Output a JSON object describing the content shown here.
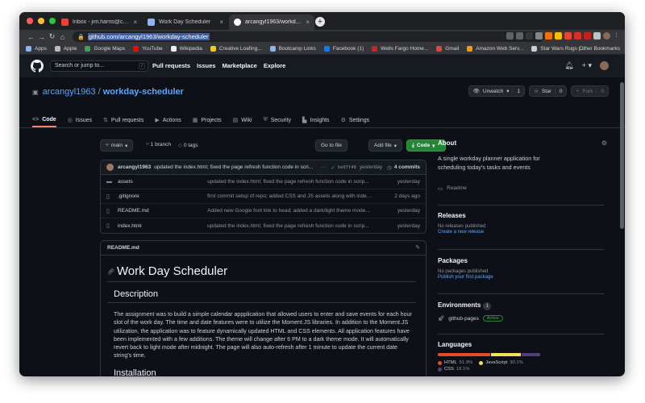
{
  "browser": {
    "tabs": [
      {
        "label": "Inbox - jim.harris@creativelo...",
        "favicon_color": "#ea4335",
        "close": "×"
      },
      {
        "label": "Work Day Scheduler",
        "favicon_color": "#8ab4f8",
        "close": "×"
      },
      {
        "label": "arcangyl1963/workday-schedul...",
        "favicon_color": "#ffffff",
        "close": "×"
      }
    ],
    "new_tab": "+",
    "url": "github.com/arcangyl1963/workday-scheduler",
    "bookmarks": [
      {
        "label": "Apps",
        "color": "#8ab4f8"
      },
      {
        "label": "Apple",
        "color": "#bbbbbb"
      },
      {
        "label": "Google Maps",
        "color": "#34a853"
      },
      {
        "label": "YouTube",
        "color": "#ff0000"
      },
      {
        "label": "Wikipedia",
        "color": "#eeeeee"
      },
      {
        "label": "Creative Loafing...",
        "color": "#ffcc00"
      },
      {
        "label": "Bootcamp Links",
        "color": "#8ab4f8"
      },
      {
        "label": "Facebook (1)",
        "color": "#1877f2"
      },
      {
        "label": "Wells Fargo Home...",
        "color": "#d71e28"
      },
      {
        "label": "Gmail",
        "color": "#ea4335"
      },
      {
        "label": "Amazon Web Serv...",
        "color": "#ff9900"
      },
      {
        "label": "Star Wars Rugs |...",
        "color": "#cccccc"
      }
    ],
    "other_bookmarks": "Other Bookmarks"
  },
  "github": {
    "search_placeholder": "Search or jump to...",
    "search_key": "/",
    "nav": [
      "Pull requests",
      "Issues",
      "Marketplace",
      "Explore"
    ],
    "owner": "arcangyl1963",
    "separator": "/",
    "repo": "workday-scheduler",
    "unwatch": {
      "label": "Unwatch",
      "count": "1"
    },
    "star": {
      "label": "Star",
      "count": "0"
    },
    "fork": {
      "label": "Fork",
      "count": "0"
    },
    "tabs": [
      {
        "label": "Code",
        "icon": "<>"
      },
      {
        "label": "Issues",
        "icon": "◎"
      },
      {
        "label": "Pull requests",
        "icon": "⇅"
      },
      {
        "label": "Actions",
        "icon": "▶"
      },
      {
        "label": "Projects",
        "icon": "▦"
      },
      {
        "label": "Wiki",
        "icon": "▤"
      },
      {
        "label": "Security",
        "icon": "⛨"
      },
      {
        "label": "Insights",
        "icon": "▙"
      },
      {
        "label": "Settings",
        "icon": "⚙"
      }
    ]
  },
  "code": {
    "branch": "main",
    "branches": "1 branch",
    "tags": "0 tags",
    "go_to_file": "Go to file",
    "add_file": "Add file",
    "code_btn": "Code",
    "commit": {
      "author": "arcangyl1963",
      "message": "updated the index.html; fixed the page refresh function code in scri...",
      "dots": "···",
      "hash": "be07f48",
      "when": "yesterday",
      "count": "4 commits"
    },
    "files": [
      {
        "name": "assets",
        "type": "dir",
        "message": "updated the index.html; fixed the page refresh function code in scrip...",
        "when": "yesterday"
      },
      {
        "name": ".gitignore",
        "type": "file",
        "message": "first commit setup of repo; added CSS and JS assets along with index...",
        "when": "2 days ago"
      },
      {
        "name": "README.md",
        "type": "file",
        "message": "Added new Google font link to head; added a dark/light theme mode; ...",
        "when": "yesterday"
      },
      {
        "name": "index.html",
        "type": "file",
        "message": "updated the index.html; fixed the page refresh function code in scrip...",
        "when": "yesterday"
      }
    ]
  },
  "readme": {
    "filename": "README.md",
    "title": "Work Day Scheduler",
    "description_heading": "Description",
    "description": "The assignment was to build a simple calendar appplication that allowed users to enter and save events for each hour slot of the work day. The time and date features were to utilize the Moment.JS libraries. In addition to the Moment.JS utilization, the application was to feature dynamically updated HTML and CSS elements. All application features have been implemented with a few additions. The theme will change after 6 PM to a dark theme mode. It will automatically revert back to light mode after midnight. The page will also auto-refresh after 1 minute to update the current date string's time.",
    "installation_heading": "Installation"
  },
  "sidebar": {
    "about_heading": "About",
    "about_text": "A single workday planner application for scheduling today's tasks and events",
    "readme_link": "Readme",
    "releases_heading": "Releases",
    "releases_none": "No releases published",
    "releases_link": "Create a new release",
    "packages_heading": "Packages",
    "packages_none": "No packages published",
    "packages_link": "Publish your first package",
    "environments_heading": "Environments",
    "environments_count": "1",
    "environment": "github-pages",
    "environment_status": "Active",
    "languages_heading": "Languages",
    "languages": [
      {
        "name": "HTML",
        "percent": "51.9%",
        "value": 51.9,
        "color": "#e34c26"
      },
      {
        "name": "JavaScript",
        "percent": "30.1%",
        "value": 30.1,
        "color": "#f1e05a"
      },
      {
        "name": "CSS",
        "percent": "18.1%",
        "value": 18.1,
        "color": "#563d7c"
      }
    ]
  }
}
